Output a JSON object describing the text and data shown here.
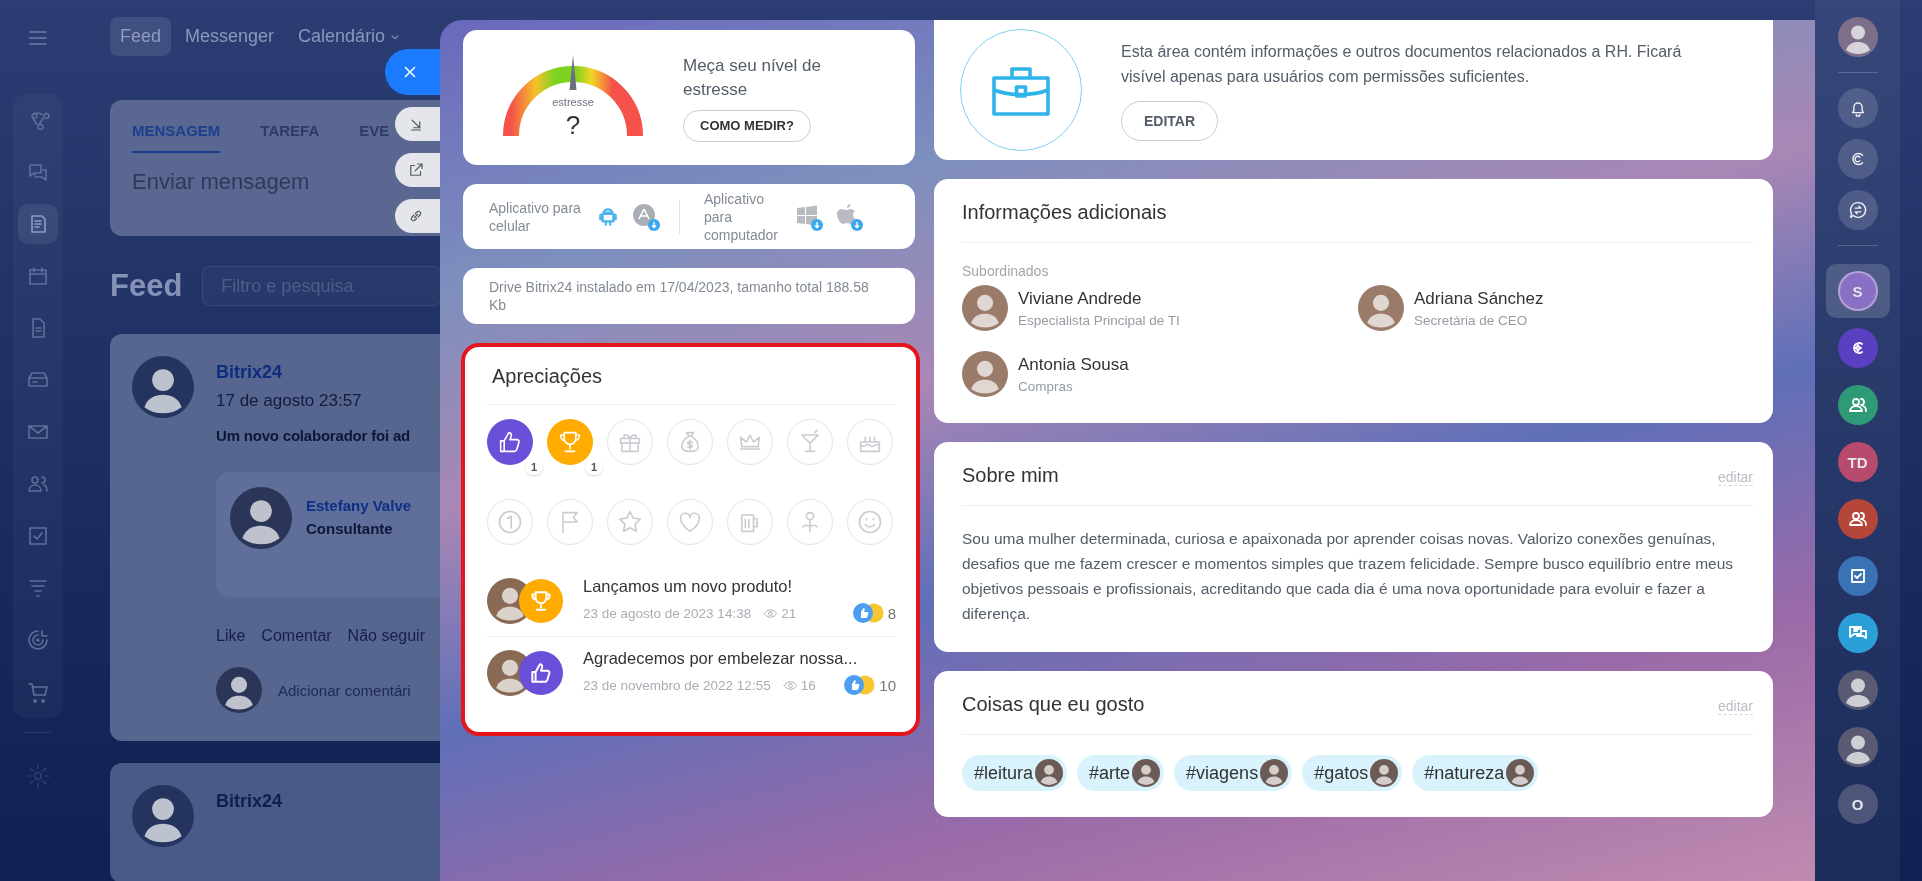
{
  "top_nav": {
    "tabs": [
      {
        "label": "Feed",
        "selected": true,
        "has_menu": false
      },
      {
        "label": "Messenger",
        "selected": false,
        "has_menu": false
      },
      {
        "label": "Calendário",
        "selected": false,
        "has_menu": true
      }
    ]
  },
  "left_sidebar": {
    "items": [
      {
        "selected": false
      },
      {
        "selected": false
      },
      {
        "selected": true
      },
      {
        "selected": false
      },
      {
        "selected": false
      },
      {
        "selected": false
      },
      {
        "selected": false
      },
      {
        "selected": false
      },
      {
        "selected": false
      },
      {
        "selected": false
      },
      {
        "selected": false
      },
      {
        "selected": false
      }
    ]
  },
  "composer": {
    "tabs": [
      {
        "label": "MENSAGEM",
        "selected": true
      },
      {
        "label": "TAREFA",
        "selected": false
      },
      {
        "label": "EVE",
        "selected": false
      }
    ],
    "placeholder": "Enviar mensagem"
  },
  "feed": {
    "title": "Feed",
    "search_placeholder": "Filtro e pesquisa",
    "posts": [
      {
        "author": "Bitrix24",
        "time": "17 de agosto 23:57",
        "text": "Um novo colaborador foi ad",
        "employee": {
          "name": "Estefany Valve",
          "role": "Consultante"
        },
        "actions": [
          "Like",
          "Comentar",
          "Não seguir"
        ],
        "comment_placeholder": "Adicionar comentári"
      },
      {
        "author": "Bitrix24"
      }
    ]
  },
  "stress": {
    "gauge_label": "estresse",
    "gauge_value": "?",
    "title": "Meça seu nível de estresse",
    "button": "COMO MEDIR?"
  },
  "apps": {
    "mobile_label": "Aplicativo para celular",
    "desktop_label": "Aplicativo para computador"
  },
  "drive_info": "Drive Bitrix24 instalado em 17/04/2023, tamanho total 188.58 Kb",
  "appreciations": {
    "title": "Apreciações",
    "badges": [
      {
        "earned": true,
        "color": "#6a4fd8",
        "count": "1"
      },
      {
        "earned": true,
        "color": "#ffab00",
        "count": "1"
      },
      {
        "earned": false
      },
      {
        "earned": false
      },
      {
        "earned": false
      },
      {
        "earned": false
      },
      {
        "earned": false
      },
      {
        "earned": false
      },
      {
        "earned": false
      },
      {
        "earned": false
      },
      {
        "earned": false
      },
      {
        "earned": false
      },
      {
        "earned": false
      },
      {
        "earned": false
      }
    ],
    "posts": [
      {
        "title": "Lançamos um novo produto!",
        "date": "23 de agosto de 2023 14:38",
        "views": "21",
        "reactions": "8",
        "kind": "trophy",
        "color": "#ffab00"
      },
      {
        "title": "Agradecemos por embelezar nossa...",
        "date": "23 de novembro de 2022 12:55",
        "views": "16",
        "reactions": "10",
        "kind": "thumbs_up",
        "color": "#6a4fd8"
      }
    ]
  },
  "hr_card": {
    "text": "Esta área contém informações e outros documentos relacionados a RH. Ficará visível apenas para usuários com permissões suficientes.",
    "button": "EDITAR"
  },
  "additional_info": {
    "title": "Informações adicionais",
    "section_label": "Subordinados",
    "people": [
      {
        "name": "Viviane Andrede",
        "role": "Especialista Principal de TI"
      },
      {
        "name": "Adriana Sánchez",
        "role": "Secretária de CEO"
      },
      {
        "name": "Antonia Sousa",
        "role": "Compras"
      }
    ]
  },
  "about": {
    "title": "Sobre mim",
    "edit": "editar",
    "text": "Sou uma mulher determinada, curiosa e apaixonada por aprender coisas novas. Valorizo conexões genuínas, desafios que me fazem crescer e momentos simples que trazem felicidade. Sempre busco equilíbrio entre meus objetivos pessoais e profissionais, acreditando que cada dia é uma nova oportunidade para evoluir e fazer a diferença."
  },
  "interests": {
    "title": "Coisas que eu gosto",
    "edit": "editar",
    "tags": [
      "#leitura",
      "#arte",
      "#viagens",
      "#gatos",
      "#natureza"
    ]
  },
  "right_bar": {
    "chats": [
      {
        "kind": "letter",
        "label": "S",
        "color": "#8a70c4",
        "selected": true
      },
      {
        "kind": "copilot",
        "color": "#5a3fc0",
        "selected": false
      },
      {
        "kind": "group",
        "color": "#2f9a78",
        "selected": false
      },
      {
        "kind": "letter",
        "label": "TD",
        "color": "#b84a6e",
        "selected": false
      },
      {
        "kind": "group",
        "color": "#b5473a",
        "selected": false
      },
      {
        "kind": "tasks",
        "color": "#3a73b5",
        "selected": false
      },
      {
        "kind": "chat",
        "color": "#2ba0d8",
        "selected": false
      },
      {
        "kind": "photo",
        "selected": false
      },
      {
        "kind": "photo",
        "selected": false
      },
      {
        "kind": "letter",
        "label": "O",
        "color": "#4d5578",
        "selected": false
      }
    ]
  }
}
